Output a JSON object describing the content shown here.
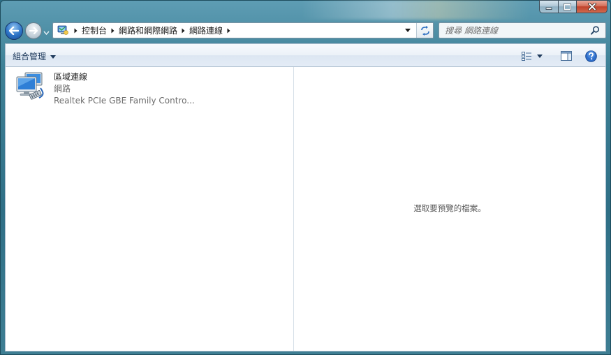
{
  "window": {
    "caption_buttons": [
      "minimize",
      "maximize",
      "close"
    ]
  },
  "address_bar": {
    "breadcrumbs": [
      "控制台",
      "網路和網際網路",
      "網路連線"
    ]
  },
  "search": {
    "placeholder": "搜尋 網路連線"
  },
  "toolbar": {
    "organize_label": "組合管理",
    "icons": [
      "change-view-icon",
      "preview-pane-icon",
      "help-icon"
    ]
  },
  "items": [
    {
      "name": "區域連線",
      "status": "網路",
      "device": "Realtek PCIe GBE Family Contro..."
    }
  ],
  "preview": {
    "message": "選取要預覽的檔案。"
  }
}
